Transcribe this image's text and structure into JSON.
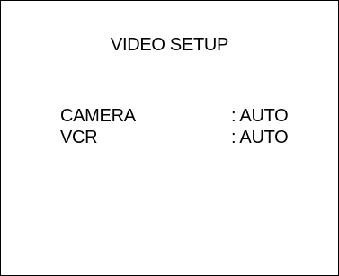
{
  "menu": {
    "title": "VIDEO SETUP",
    "items": [
      {
        "label": "CAMERA",
        "value": ": AUTO"
      },
      {
        "label": "VCR",
        "value": ": AUTO"
      }
    ]
  },
  "colors": {
    "background": "#ffffff",
    "text": "#000000",
    "border": "#000000"
  }
}
